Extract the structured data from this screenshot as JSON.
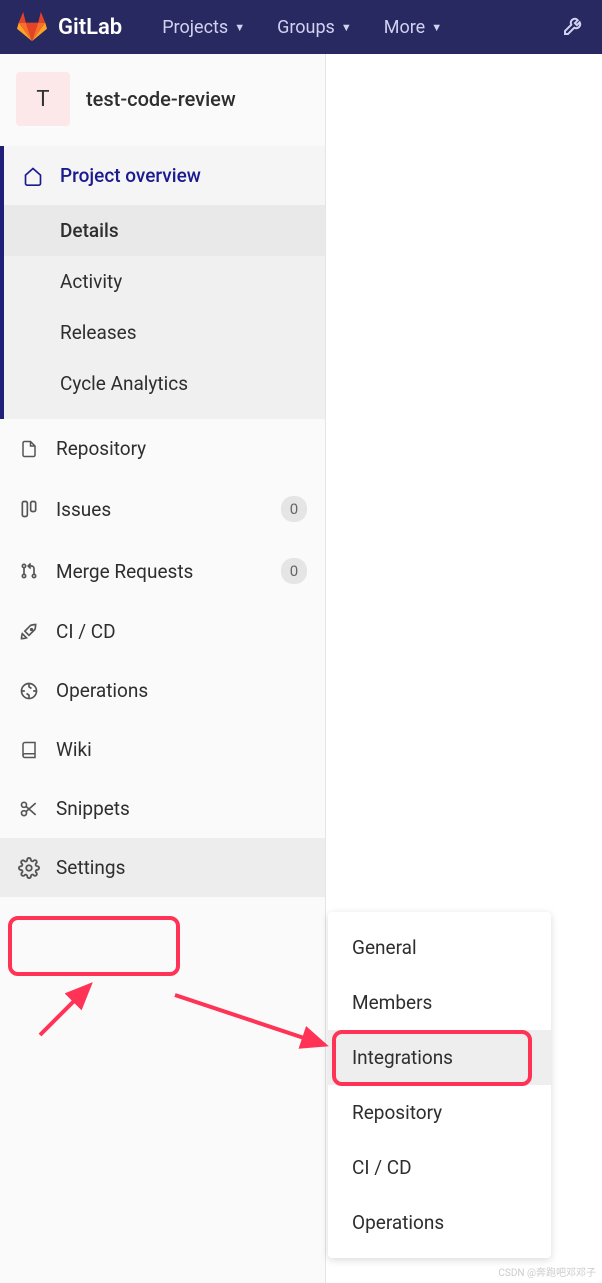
{
  "topnav": {
    "brand": "GitLab",
    "items": [
      "Projects",
      "Groups",
      "More"
    ]
  },
  "project": {
    "avatar_letter": "T",
    "name": "test-code-review"
  },
  "sidebar": {
    "overview": {
      "label": "Project overview",
      "subitems": [
        "Details",
        "Activity",
        "Releases",
        "Cycle Analytics"
      ],
      "active_sub": "Details"
    },
    "items": [
      {
        "label": "Repository",
        "icon": "doc"
      },
      {
        "label": "Issues",
        "icon": "issues",
        "badge": "0"
      },
      {
        "label": "Merge Requests",
        "icon": "merge",
        "badge": "0"
      },
      {
        "label": "CI / CD",
        "icon": "rocket"
      },
      {
        "label": "Operations",
        "icon": "ops"
      },
      {
        "label": "Wiki",
        "icon": "book"
      },
      {
        "label": "Snippets",
        "icon": "scissors"
      },
      {
        "label": "Settings",
        "icon": "gear"
      }
    ]
  },
  "flyout": {
    "items": [
      "General",
      "Members",
      "Integrations",
      "Repository",
      "CI / CD",
      "Operations"
    ],
    "active": "Integrations"
  },
  "watermark": "CSDN @奔跑吧邓邓子"
}
